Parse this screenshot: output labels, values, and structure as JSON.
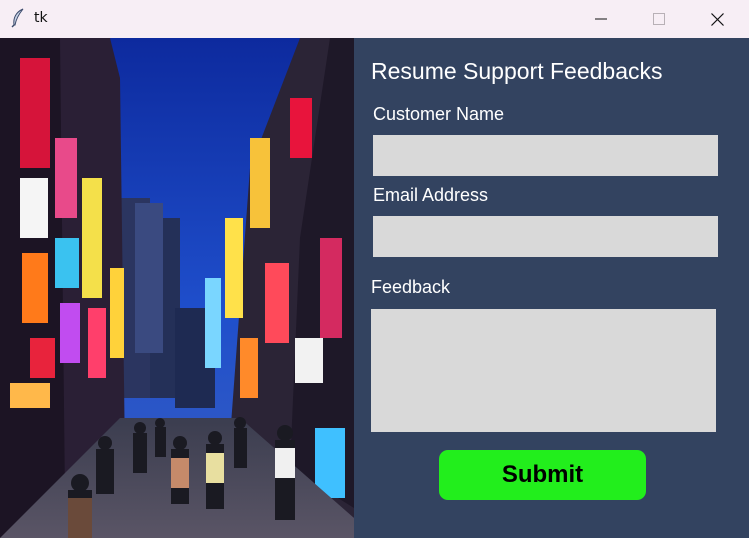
{
  "window": {
    "title": "tk",
    "icons": {
      "app": "feather-icon",
      "minimize": "minimize-icon",
      "maximize": "maximize-icon",
      "close": "close-icon"
    }
  },
  "photo": {
    "subject": "neon-lit city street at dusk"
  },
  "form": {
    "heading": "Resume Support Feedbacks",
    "customer_name_label": "Customer Name",
    "customer_name_value": "",
    "email_label": "Email Address",
    "email_value": "",
    "feedback_label": "Feedback",
    "feedback_value": "",
    "submit_label": "Submit"
  },
  "colors": {
    "panel_bg": "#334360",
    "field_bg": "#d9d9d9",
    "submit_bg": "#22ee1c",
    "titlebar_bg": "#f7eef5"
  }
}
